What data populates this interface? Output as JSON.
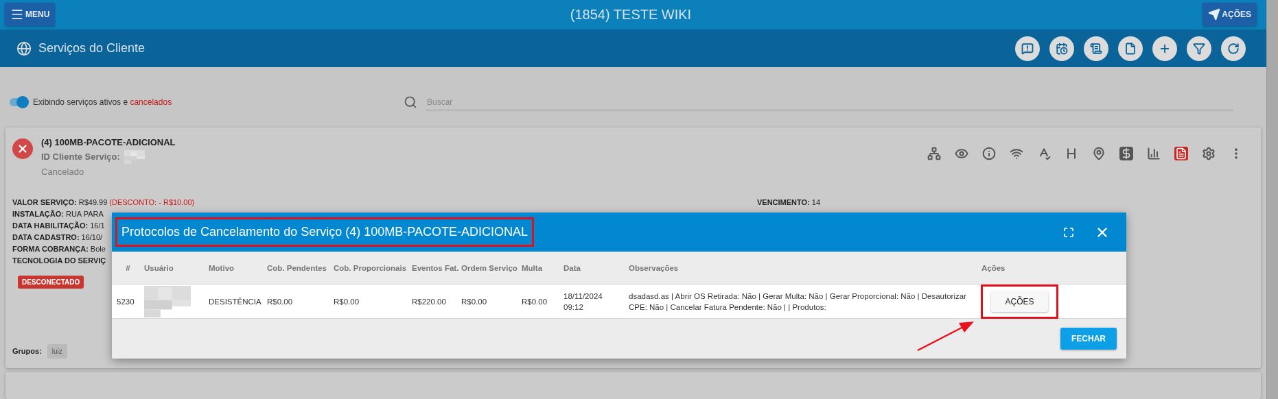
{
  "topbar": {
    "menu_label": "MENU",
    "title": "(1854) TESTE WIKI",
    "actions_label": "AÇÕES"
  },
  "header": {
    "title": "Serviços do Cliente"
  },
  "filter": {
    "toggle_on": true,
    "label": "Exibindo serviços ativos e",
    "label_highlight": "cancelados",
    "search_placeholder": "Buscar"
  },
  "service": {
    "name": "(4) 100MB-PACOTE-ADICIONAL",
    "id_label": "ID Cliente Serviço:",
    "status": "Cancelado",
    "fields": [
      {
        "label": "VALOR SERVIÇO:",
        "value": "R$49.99",
        "note": "(DESCONTO: - R$10.00)"
      },
      {
        "label": "INSTALAÇÃO:",
        "value": "RUA PARA"
      },
      {
        "label": "DATA HABILITAÇÃO:",
        "value": "16/1"
      },
      {
        "label": "DATA CADASTRO:",
        "value": "16/10/"
      },
      {
        "label": "FORMA COBRANÇA:",
        "value": "Bole"
      },
      {
        "label": "TECNOLOGIA DO SERVIÇ"
      }
    ],
    "due": {
      "label": "VENCIMENTO:",
      "value": "14"
    },
    "badge": "DESCONECTADO",
    "groups_label": "Grupos:",
    "groups": [
      "luiz"
    ]
  },
  "modal": {
    "title": "Protocolos de Cancelamento do Serviço (4) 100MB-PACOTE-ADICIONAL",
    "columns": [
      "#",
      "Usuário",
      "Motivo",
      "Cob. Pendentes",
      "Cob. Proporcionais",
      "Eventos Fat.",
      "Ordem Serviço",
      "Multa",
      "Data",
      "Observações",
      "Ações"
    ],
    "rows": [
      {
        "number": "5230",
        "reason": "DESISTÊNCIA",
        "pending_charges": "R$0.00",
        "proportional_charges": "R$0.00",
        "billing_events": "R$220.00",
        "service_order": "R$0.00",
        "fine": "R$0.00",
        "date": "18/11/2024 09:12",
        "notes": "dsadasd.as | Abrir OS Retirada: Não | Gerar Multa: Não | Gerar Proporcional: Não | Desautorizar CPE: Não | Cancelar Fatura Pendente: Não | | Produtos:",
        "action_label": "AÇÕES"
      }
    ],
    "close_label": "FECHAR"
  }
}
